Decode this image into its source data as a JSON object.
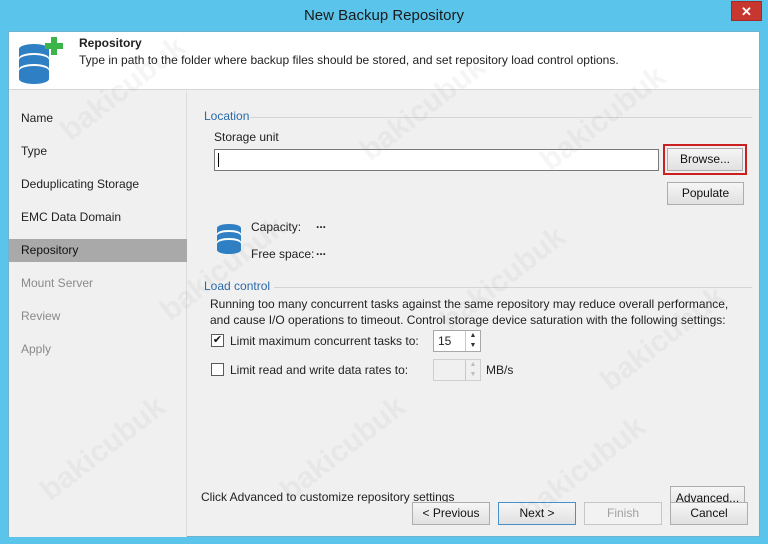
{
  "window": {
    "title": "New Backup Repository",
    "close_glyph": "✕"
  },
  "header": {
    "title": "Repository",
    "description": "Type in path to the folder where backup files should be stored, and set repository load control options."
  },
  "steps": [
    {
      "label": "Name",
      "state": "done"
    },
    {
      "label": "Type",
      "state": "done"
    },
    {
      "label": "Deduplicating Storage",
      "state": "done"
    },
    {
      "label": "EMC Data Domain",
      "state": "done"
    },
    {
      "label": "Repository",
      "state": "active"
    },
    {
      "label": "Mount Server",
      "state": "disabled"
    },
    {
      "label": "Review",
      "state": "disabled"
    },
    {
      "label": "Apply",
      "state": "disabled"
    }
  ],
  "location": {
    "section_label": "Location",
    "storage_unit_label": "Storage unit",
    "storage_unit_value": "",
    "browse_label": "Browse...",
    "populate_label": "Populate",
    "capacity_label": "Capacity:",
    "capacity_value": "...",
    "free_space_label": "Free space:",
    "free_space_value": "..."
  },
  "load_control": {
    "section_label": "Load control",
    "description_line1": "Running too many concurrent tasks against the same repository may reduce overall performance,",
    "description_line2": "and cause I/O operations to timeout. Control storage device saturation with the following settings:",
    "limit_tasks_label": "Limit maximum concurrent tasks to:",
    "limit_tasks_checked": true,
    "limit_tasks_value": "15",
    "limit_rate_label": "Limit read and write data rates to:",
    "limit_rate_checked": false,
    "limit_rate_value": "",
    "limit_rate_unit": "MB/s"
  },
  "advanced": {
    "text": "Click Advanced to customize repository settings",
    "button_label": "Advanced..."
  },
  "footer": {
    "previous_label": "< Previous",
    "next_label": "Next >",
    "finish_label": "Finish",
    "cancel_label": "Cancel"
  },
  "colors": {
    "window_frame": "#5bc4ea",
    "close_button": "#c7372f",
    "section_label": "#2a6aa8",
    "active_step": "#a9a9a9",
    "focus_ring": "#cc1f1f",
    "db_icon": "#2e7fc4",
    "plus_icon": "#3bb44a"
  },
  "watermark_text": "bakicubuk"
}
